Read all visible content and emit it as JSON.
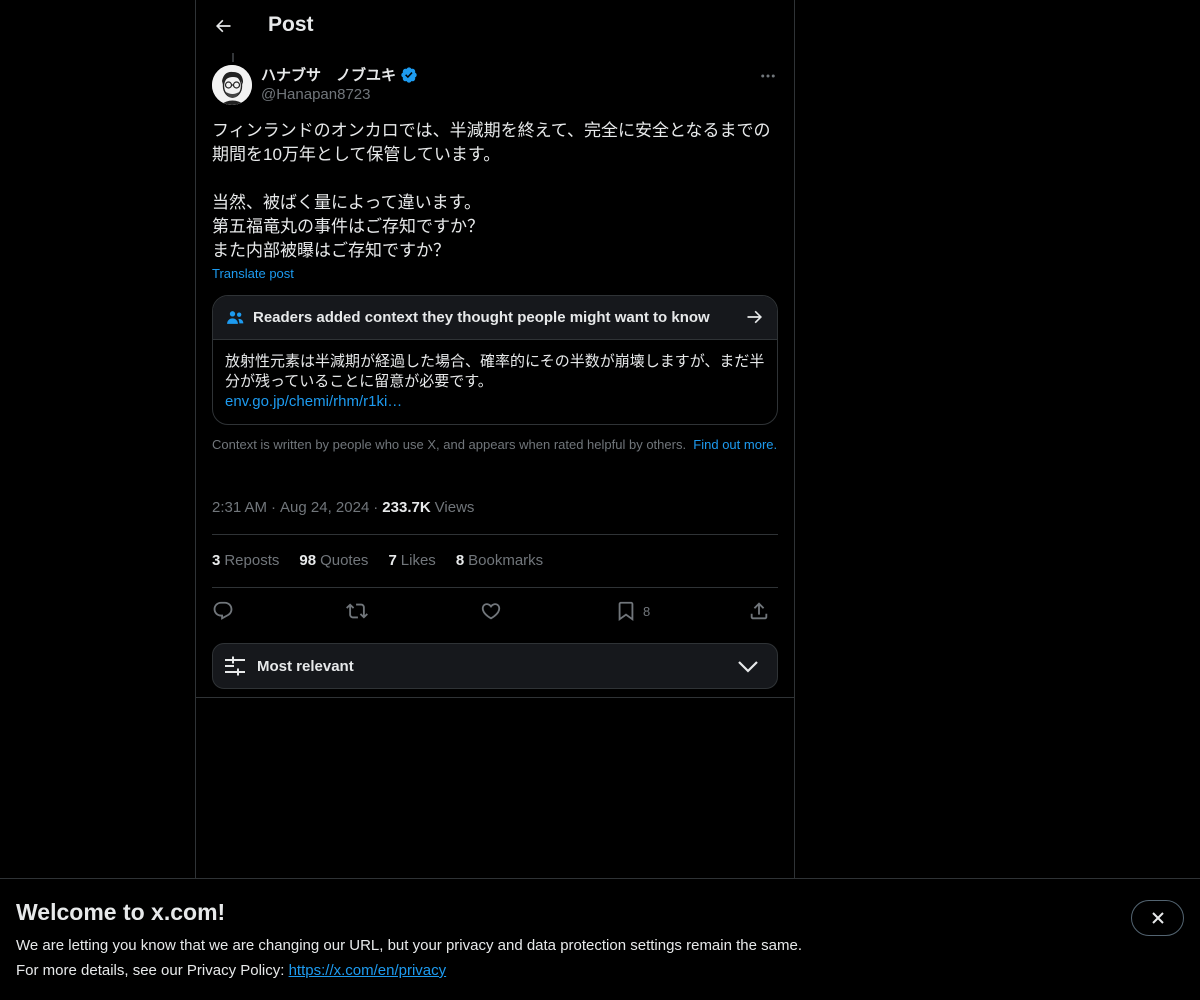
{
  "header": {
    "title": "Post",
    "back_icon": "arrow-left-icon"
  },
  "author": {
    "display_name": "ハナブサ　ノブユキ",
    "handle": "@Hanapan8723",
    "verified": true,
    "verified_color": "#1d9bf0",
    "avatar_icon": "avatar-icon"
  },
  "post": {
    "text_paragraphs": [
      "フィンランドのオンカロでは、半減期を終えて、完全に安全となるまでの期間を10万年として保管しています。",
      "",
      "当然、被ばく量によって違います。",
      "第五福竜丸の事件はご存知ですか？",
      "また内部被曝はご存知ですか？"
    ],
    "translate_label": "Translate post"
  },
  "community_note": {
    "heading": "Readers added context they thought people might want to know",
    "body": "放射性元素は半減期が経過した場合、確率的にその半数が崩壊しますが、まだ半分が残っていることに留意が必要です。",
    "link": "env.go.jp/chemi/rhm/r1ki…",
    "footer_text": "Context is written by people who use X, and appears when rated helpful by others.",
    "footer_link": "Find out more."
  },
  "meta": {
    "time": "2:31 AM",
    "date": "Aug 24, 2024",
    "views_count": "233.7K",
    "views_label": "Views",
    "separator": "·"
  },
  "stats": [
    {
      "count": "3",
      "label": "Reposts"
    },
    {
      "count": "98",
      "label": "Quotes"
    },
    {
      "count": "7",
      "label": "Likes"
    },
    {
      "count": "8",
      "label": "Bookmarks"
    }
  ],
  "actions": {
    "reply_icon": "reply-icon",
    "repost_icon": "repost-icon",
    "like_icon": "heart-icon",
    "bookmark_icon": "bookmark-icon",
    "bookmark_count": "8",
    "share_icon": "share-icon"
  },
  "sort": {
    "label": "Most relevant"
  },
  "banner": {
    "title": "Welcome to x.com!",
    "line1": "We are letting you know that we are changing our URL, but your privacy and data protection settings remain the same.",
    "line2_prefix": "For more details, see our Privacy Policy: ",
    "privacy_link": "https://x.com/en/privacy"
  },
  "colors": {
    "background": "#000000",
    "text_primary": "#e7e9ea",
    "text_secondary": "#71767b",
    "accent": "#1d9bf0",
    "border": "#2f3336"
  }
}
